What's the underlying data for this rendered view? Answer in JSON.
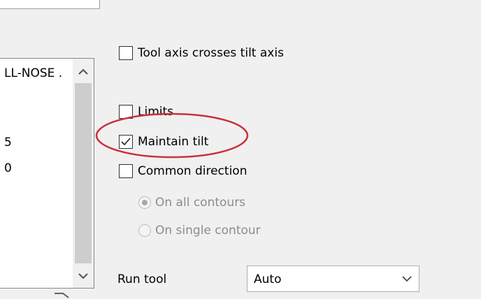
{
  "tool_list": {
    "rows": [
      "LL-NOSE .",
      "5",
      "0"
    ]
  },
  "options": {
    "tool_axis_crosses": {
      "label": "Tool axis crosses tilt axis",
      "checked": false
    },
    "limits": {
      "label": "Limits",
      "checked": false
    },
    "maintain_tilt": {
      "label": "Maintain tilt",
      "checked": true
    },
    "common_direction": {
      "label": "Common direction",
      "checked": false
    }
  },
  "direction_radios": {
    "on_all_contours": {
      "label": "On all contours",
      "selected": true,
      "enabled": false
    },
    "on_single_contour": {
      "label": "On single contour",
      "selected": false,
      "enabled": false
    }
  },
  "run_tool": {
    "label": "Run tool",
    "value": "Auto"
  },
  "colors": {
    "highlight": "#c8323c",
    "panel_bg": "#f0f0f0",
    "disabled_text": "#8c8c8c"
  }
}
